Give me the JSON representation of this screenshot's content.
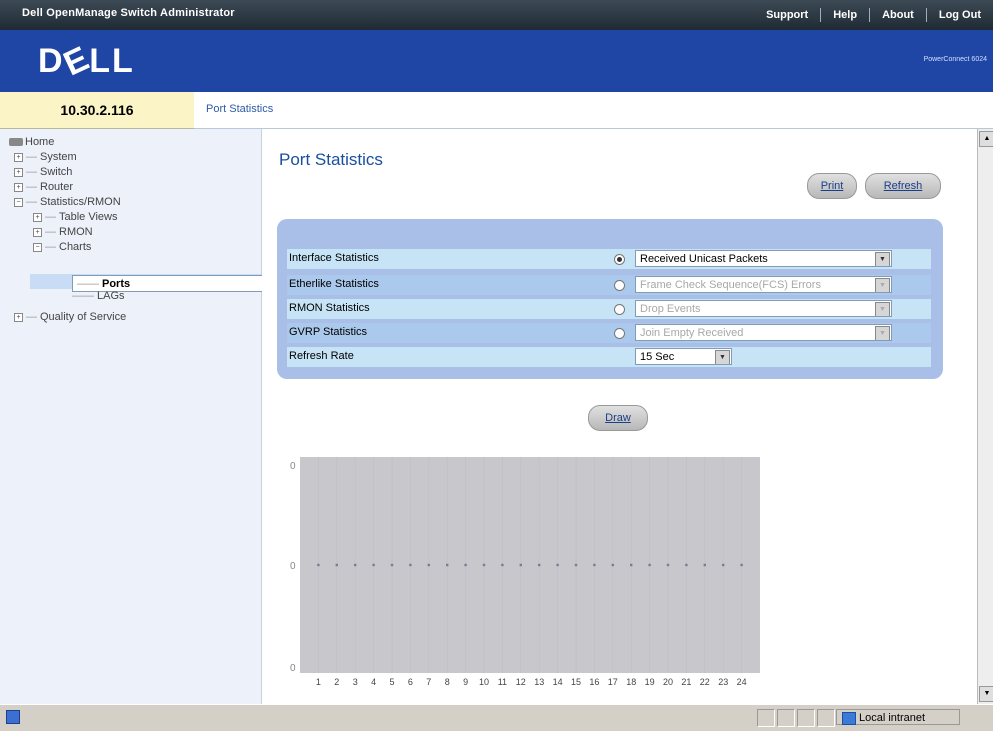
{
  "app": {
    "title": "Dell OpenManage Switch Administrator",
    "links": [
      "Support",
      "Help",
      "About",
      "Log Out"
    ]
  },
  "banner": {
    "logo": "DELL",
    "product": "PowerConnect 6024"
  },
  "device": {
    "ip": "10.30.2.116"
  },
  "breadcrumb": "Port Statistics",
  "nav": {
    "home": "Home",
    "system": "System",
    "switch": "Switch",
    "router": "Router",
    "statistics": "Statistics/RMON",
    "table_views": "Table Views",
    "rmon": "RMON",
    "charts": "Charts",
    "ports": "Ports",
    "lags": "LAGs",
    "qos": "Quality of Service"
  },
  "page": {
    "title": "Port Statistics",
    "print_label": "Print",
    "refresh_label": "Refresh",
    "draw_label": "Draw"
  },
  "form": {
    "interface": {
      "label": "Interface Statistics",
      "value": "Received Unicast Packets",
      "selected": true
    },
    "etherlike": {
      "label": "Etherlike Statistics",
      "value": "Frame Check Sequence(FCS) Errors",
      "selected": false
    },
    "rmon": {
      "label": "RMON Statistics",
      "value": "Drop Events",
      "selected": false
    },
    "gvrp": {
      "label": "GVRP Statistics",
      "value": "Join Empty Received",
      "selected": false
    },
    "refresh": {
      "label": "Refresh Rate",
      "value": "15 Sec"
    }
  },
  "chart_data": {
    "type": "line",
    "categories": [
      "1",
      "2",
      "3",
      "4",
      "5",
      "6",
      "7",
      "8",
      "9",
      "10",
      "11",
      "12",
      "13",
      "14",
      "15",
      "16",
      "17",
      "18",
      "19",
      "20",
      "21",
      "22",
      "23",
      "24"
    ],
    "series": [
      {
        "values": [
          0,
          0,
          0,
          0,
          0,
          0,
          0,
          0,
          0,
          0,
          0,
          0,
          0,
          0,
          0,
          0,
          0,
          0,
          0,
          0,
          0,
          0,
          0,
          0
        ]
      }
    ],
    "y_tick_labels": [
      "0",
      "0",
      "0"
    ],
    "colors": {
      "background": "#c8c8cc",
      "line": "#7a7a9a"
    }
  },
  "status": {
    "zone": "Local intranet"
  }
}
